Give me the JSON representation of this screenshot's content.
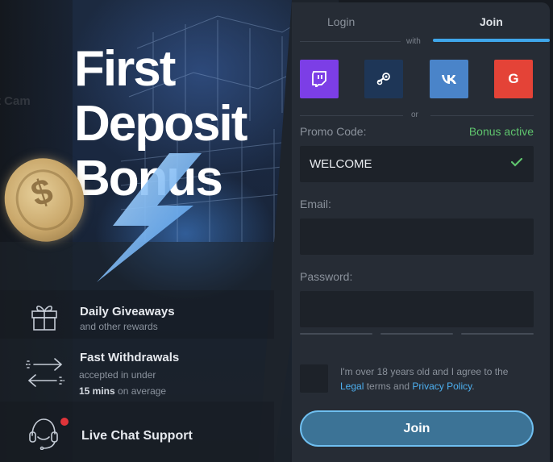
{
  "promo": {
    "ghost_text": "t Cam",
    "headline": [
      "First",
      "Deposit",
      "Bonus"
    ],
    "coin_symbol": "$",
    "features": [
      {
        "title": "Daily Giveaways",
        "sub": "and other rewards",
        "icon": "gift-icon"
      },
      {
        "title": "Fast Withdrawals",
        "sub1": "accepted in under",
        "sub2_bold": "15 mins",
        "sub2_rest": "on average",
        "icon": "transfer-arrows-icon"
      },
      {
        "title": "Live Chat Support",
        "icon": "headset-icon"
      }
    ]
  },
  "auth": {
    "tabs": {
      "login": "Login",
      "join": "Join",
      "active": "join"
    },
    "with_label": "with",
    "or_label": "or",
    "social": [
      "twitch-icon",
      "steam-icon",
      "vk-icon",
      "google-icon"
    ],
    "google_letter": "G",
    "promo_code": {
      "label": "Promo Code:",
      "value": "WELCOME",
      "status": "Bonus active"
    },
    "email": {
      "label": "Email:",
      "value": ""
    },
    "password": {
      "label": "Password:",
      "value": ""
    },
    "agree": {
      "text1": "I'm over 18 years old and I agree to the",
      "legal": "Legal",
      "text2": "terms and",
      "privacy": "Privacy Policy",
      "text3": "."
    },
    "join_button": "Join"
  },
  "colors": {
    "accent": "#3fa6ea",
    "success": "#5fc46d",
    "twitch": "#7c3ee6",
    "steam": "#1e3657",
    "vk": "#4a84c9",
    "google": "#e44337",
    "notification_dot": "#e0343a"
  }
}
